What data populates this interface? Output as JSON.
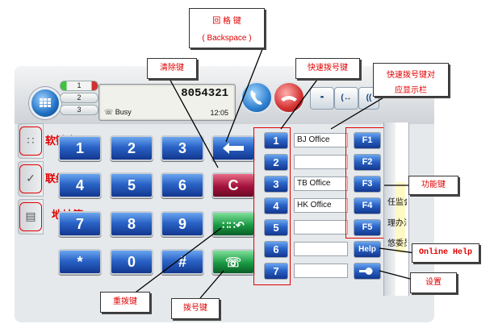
{
  "device": {
    "menu_icon": "grid-menu-icon",
    "lines": [
      "1",
      "2",
      "3"
    ],
    "lcd": {
      "number": "8054321",
      "status": "Busy",
      "time": "12:05"
    },
    "top_func_icons": [
      "headset-icon",
      "transfer-icon",
      "conference-icon"
    ]
  },
  "side_tabs": [
    {
      "icon": "keypad-icon",
      "label": "软键盘"
    },
    {
      "icon": "history-icon",
      "label": "联络历史"
    },
    {
      "icon": "book-icon",
      "label": "地址簿"
    }
  ],
  "keypad": [
    "1",
    "2",
    "3",
    "4",
    "5",
    "6",
    "7",
    "8",
    "9",
    "*",
    "0",
    "#"
  ],
  "keys": {
    "backspace_icon": "arrow-left-icon",
    "clear": "C",
    "redial_icon": "redial-icon",
    "dial_icon": "phone-icon"
  },
  "speed_dial": {
    "numbers": [
      "1",
      "2",
      "3",
      "4",
      "5",
      "6",
      "7"
    ],
    "labels": [
      "BJ Office",
      "",
      "TB Office",
      "HK Office",
      "",
      "",
      ""
    ]
  },
  "function_keys": [
    "F1",
    "F2",
    "F3",
    "F4",
    "F5",
    "Help"
  ],
  "settings_icon": "wrench-icon",
  "sidebar_snippets": [
    "任监会周-",
    "理办法(",
    "悠委员会"
  ],
  "callouts": {
    "backspace_line1": "回  格  键",
    "backspace_line2": "( Backspace )",
    "clear": "清除键",
    "speed_dial": "快速拨号键",
    "speed_dial_display_line1": "快速拨号键对",
    "speed_dial_display_line2": "应显示栏",
    "function_keys": "功能键",
    "online_help": "Online Help",
    "settings": "设置",
    "redial": "重拨键",
    "dial": "拨号键"
  }
}
